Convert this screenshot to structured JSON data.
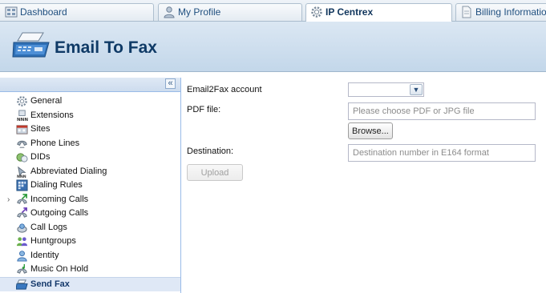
{
  "tabs": [
    {
      "label": "Dashboard",
      "icon": "dashboard-icon"
    },
    {
      "label": "My Profile",
      "icon": "user-icon"
    },
    {
      "label": "IP Centrex",
      "icon": "gear-icon"
    },
    {
      "label": "Billing Informatio",
      "icon": "document-icon"
    }
  ],
  "active_tab": "IP Centrex",
  "banner": {
    "title": "Email To Fax",
    "icon": "fax-machine-icon"
  },
  "sidebar": {
    "collapse_label": "«",
    "items": [
      {
        "label": "General",
        "icon": "gear-icon"
      },
      {
        "label": "Extensions",
        "icon": "extensions-icon"
      },
      {
        "label": "Sites",
        "icon": "sites-icon"
      },
      {
        "label": "Phone Lines",
        "icon": "phone-lines-icon"
      },
      {
        "label": "DIDs",
        "icon": "dids-icon"
      },
      {
        "label": "Abbreviated Dialing",
        "icon": "abbreviated-dialing-icon"
      },
      {
        "label": "Dialing Rules",
        "icon": "dialing-rules-icon"
      },
      {
        "label": "Incoming Calls",
        "icon": "incoming-calls-icon",
        "expander": "›"
      },
      {
        "label": "Outgoing Calls",
        "icon": "outgoing-calls-icon"
      },
      {
        "label": "Call Logs",
        "icon": "call-logs-icon"
      },
      {
        "label": "Huntgroups",
        "icon": "huntgroups-icon"
      },
      {
        "label": "Identity",
        "icon": "identity-icon"
      },
      {
        "label": "Music On Hold",
        "icon": "music-on-hold-icon"
      },
      {
        "label": "Send Fax",
        "icon": "fax-icon"
      }
    ],
    "selected": "Send Fax"
  },
  "form": {
    "account_label": "Email2Fax account",
    "account_value": "",
    "pdf_label": "PDF file:",
    "pdf_placeholder": "Please choose PDF or JPG file",
    "browse_label": "Browse...",
    "destination_label": "Destination:",
    "destination_placeholder": "Destination number in E164 format",
    "upload_label": "Upload"
  },
  "colors": {
    "accent": "#0f3a66",
    "banner_bg": "#c3d7ea",
    "selected_row": "#dfe8f6"
  }
}
